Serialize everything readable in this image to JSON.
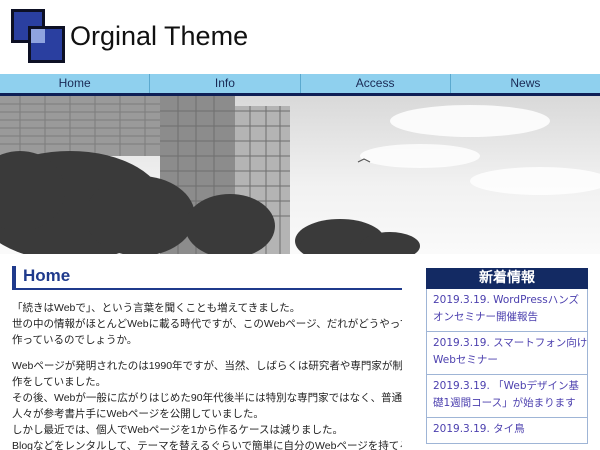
{
  "site": {
    "title": "Orginal Theme",
    "logo_icon": "overlapping-blue-squares-logo"
  },
  "nav": {
    "items": [
      {
        "label": "Home"
      },
      {
        "label": "Info"
      },
      {
        "label": "Access"
      },
      {
        "label": "News"
      }
    ]
  },
  "hero": {
    "image": "grayscale-city-buildings-trees-photo"
  },
  "main": {
    "heading": "Home",
    "paragraphs": [
      {
        "lines": [
          "「続きはWebで」、という言葉を聞くことも増えてきました。",
          "世の中の情報がほとんどWebに載る時代ですが、このWebページ、だれがどうやって",
          "作っているのでしょうか。"
        ]
      },
      {
        "lines": [
          "Webページが発明されたのは1990年ですが、当然、しばらくは研究者や専門家が制",
          "作をしていました。",
          "その後、Webが一般に広がりはじめた90年代後半には特別な専門家ではなく、普通の",
          "人々が参考書片手にWebページを公開していました。",
          "しかし最近では、個人でWebページを1から作るケースは減りました。",
          "Blogなどをレンタルして、テーマを替えるぐらいで簡単に自分のWebページを持てる"
        ]
      }
    ]
  },
  "sidebar": {
    "heading": "新着情報",
    "news": [
      {
        "lines": [
          "2019.3.19. WordPressハンズ",
          "オンセミナー開催報告"
        ]
      },
      {
        "lines": [
          "2019.3.19. スマートフォン向け",
          "Webセミナー"
        ]
      },
      {
        "lines": [
          "2019.3.19. 「Webデザイン基",
          "礎1週間コース」が始まります"
        ]
      },
      {
        "lines": [
          "2019.3.19. タイ鳥"
        ]
      }
    ]
  },
  "colors": {
    "nav_bg": "#8fd0ee",
    "nav_border": "#0e1f56",
    "accent": "#1f3a8c",
    "sidebar_heading_bg": "#132a63",
    "link": "#4b3fae"
  }
}
